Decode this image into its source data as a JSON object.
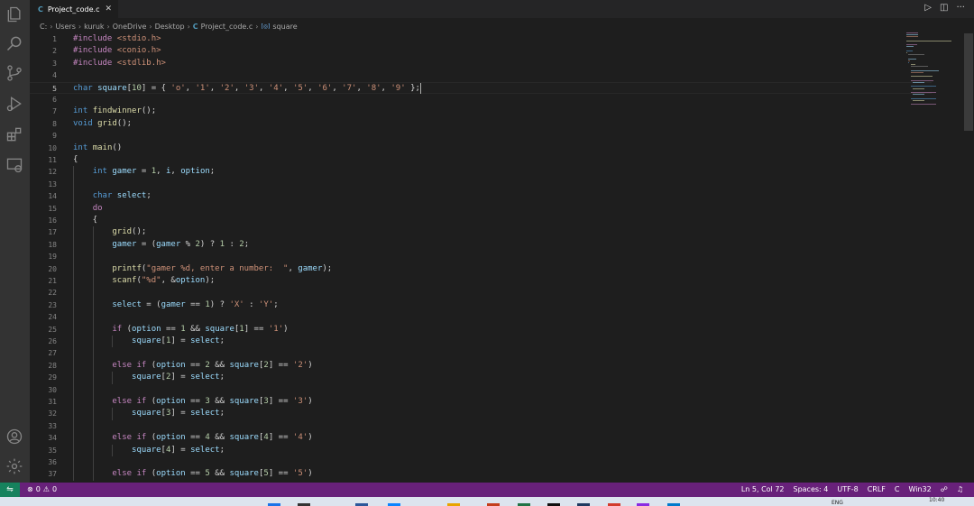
{
  "tab": {
    "icon": "c-file-icon",
    "label": "Project_code.c",
    "close": "✕"
  },
  "breadcrumb": {
    "items": [
      "C:",
      "Users",
      "kuruk",
      "OneDrive",
      "Desktop"
    ],
    "file": "Project_code.c",
    "symbol": "square",
    "separator": "›"
  },
  "editor": {
    "active_line": 5,
    "lines": [
      "#include <stdio.h>",
      "#include <conio.h>",
      "#include <stdlib.h>",
      "",
      "char square[10] = { 'o', '1', '2', '3', '4', '5', '6', '7', '8', '9' };",
      "",
      "int findwinner();",
      "void grid();",
      "",
      "int main()",
      "{",
      "    int gamer = 1, i, option;",
      "",
      "    char select;",
      "    do",
      "    {",
      "        grid();",
      "        gamer = (gamer % 2) ? 1 : 2;",
      "",
      "        printf(\"gamer %d, enter a number:  \", gamer);",
      "        scanf(\"%d\", &option);",
      "",
      "        select = (gamer == 1) ? 'X' : 'Y';",
      "",
      "        if (option == 1 && square[1] == '1')",
      "            square[1] = select;",
      "",
      "        else if (option == 2 && square[2] == '2')",
      "            square[2] = select;",
      "",
      "        else if (option == 3 && square[3] == '3')",
      "            square[3] = select;",
      "",
      "        else if (option == 4 && square[4] == '4')",
      "            square[4] = select;",
      "",
      "        else if (option == 5 && square[5] == '5')"
    ]
  },
  "statusbar": {
    "errors": "0",
    "warnings": "0",
    "position": "Ln 5, Col 72",
    "spaces": "Spaces: 4",
    "encoding": "UTF-8",
    "eol": "CRLF",
    "language": "C",
    "platform": "Win32"
  },
  "taskbar": {
    "lang": "ENG",
    "time": "10:40"
  },
  "colors": {
    "keyword": "#569cd6",
    "control": "#c586c0",
    "function": "#dcdcaa",
    "variable": "#9cdcfe",
    "string": "#ce9178",
    "number": "#b5cea8",
    "statusbar": "#68217a"
  }
}
